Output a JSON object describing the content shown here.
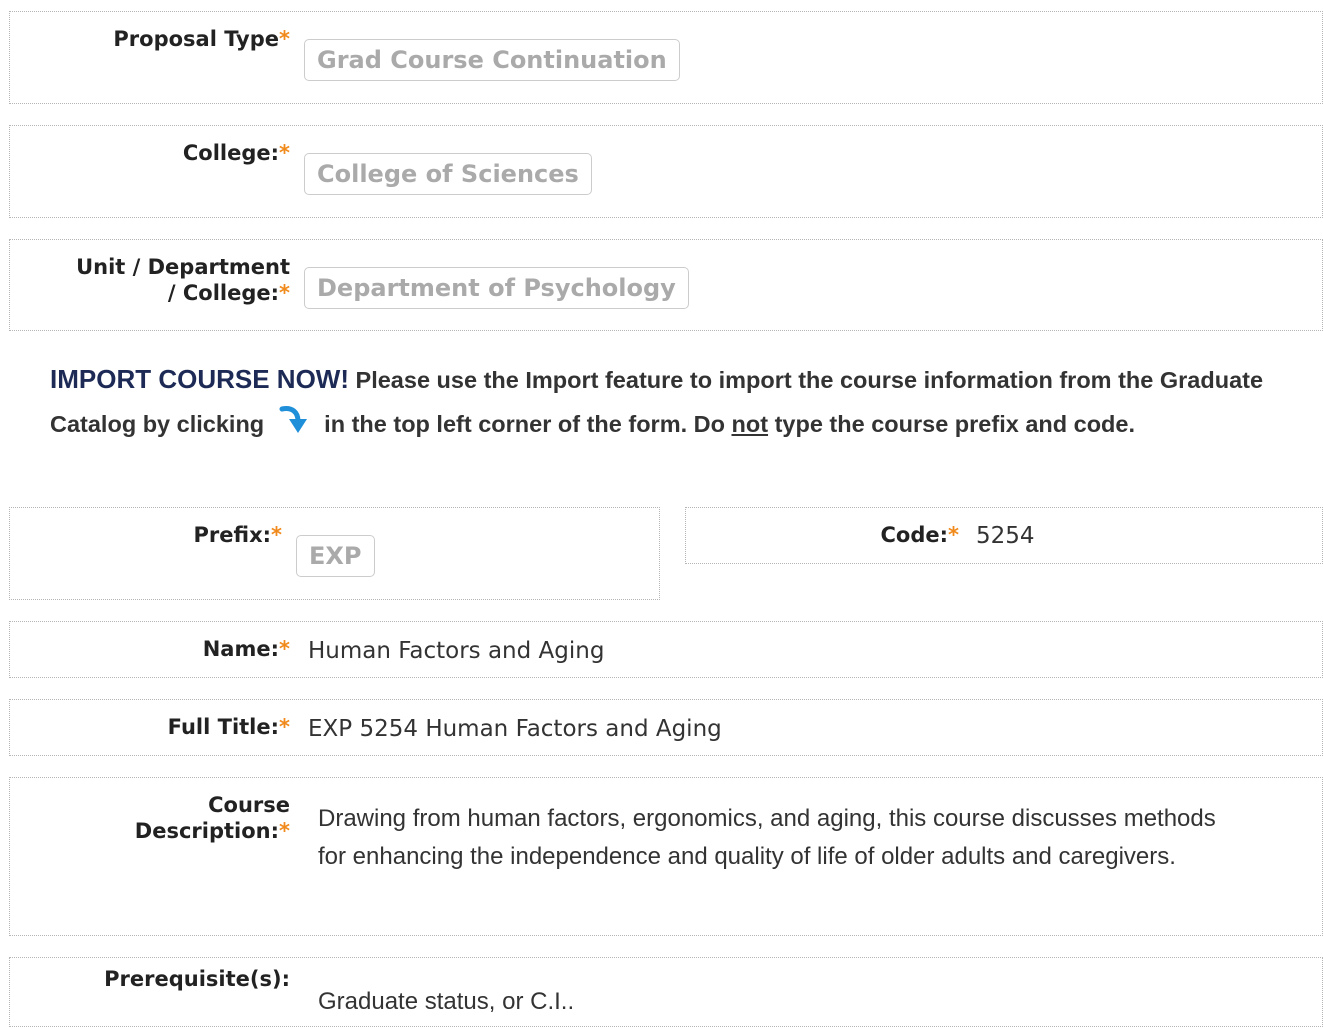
{
  "required_marker": "*",
  "proposal_type": {
    "label": "Proposal Type",
    "value": "Grad Course Continuation"
  },
  "college": {
    "label": "College:",
    "value": "College of Sciences"
  },
  "unit": {
    "label_line1": "Unit / Department",
    "label_line2": "/ College:",
    "value": "Department of Psychology"
  },
  "import_notice": {
    "heading": "IMPORT COURSE NOW!",
    "text_before_icon": "Please use the Import feature to import the course information from the Graduate Catalog by clicking",
    "icon": "import-arrow-icon",
    "text_after_icon": "in the top left corner of the form. Do",
    "emphasis": "not",
    "text_end": "type the course prefix and code."
  },
  "prefix": {
    "label": "Prefix:",
    "value": "EXP"
  },
  "code": {
    "label": "Code:",
    "value": "5254"
  },
  "name": {
    "label": "Name:",
    "value": "Human Factors and Aging"
  },
  "full_title": {
    "label": "Full Title:",
    "value": "EXP 5254 Human Factors and Aging"
  },
  "course_description": {
    "label_line1": "Course",
    "label_line2": "Description:",
    "value": "Drawing from human factors, ergonomics, and aging, this course discusses methods for enhancing the independence and quality of life of older adults and caregivers."
  },
  "prerequisites": {
    "label": "Prerequisite(s):",
    "value": "Graduate status, or C.I.."
  },
  "colors": {
    "required": "#f08a1c",
    "accent_arrow": "#1e8fd8",
    "heading": "#1c2a55"
  }
}
